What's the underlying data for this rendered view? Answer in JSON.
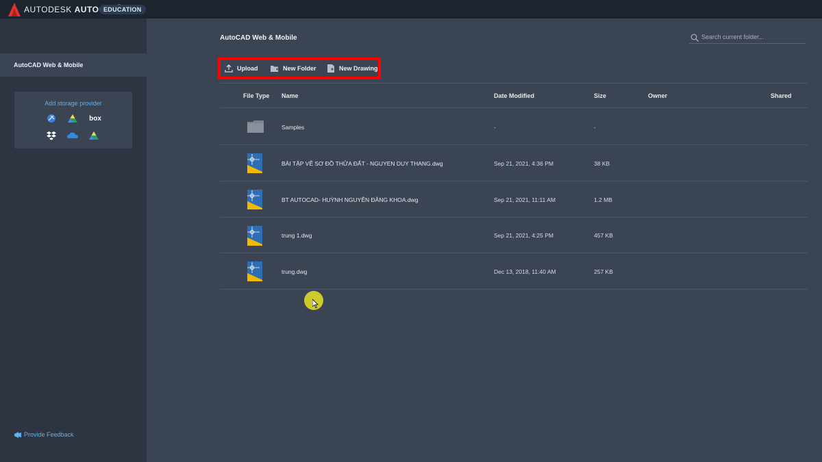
{
  "app": {
    "brand_company": "AUTODESK",
    "brand_product": "AUTOCAD",
    "brand_mark": "®",
    "edition_badge": "EDUCATION"
  },
  "sidebar": {
    "item_label": "AutoCAD Web & Mobile",
    "storage_title": "Add storage provider",
    "providers": [
      "autocad-web-icon",
      "google-drive-icon",
      "box-icon",
      "dropbox-icon",
      "onedrive-icon",
      "google-drive-icon"
    ],
    "box_label": "box",
    "feedback_label": "Provide Feedback"
  },
  "main": {
    "title": "AutoCAD Web & Mobile",
    "search_placeholder": "Search current folder..."
  },
  "toolbar": {
    "upload_label": "Upload",
    "new_folder_label": "New Folder",
    "new_drawing_label": "New Drawing",
    "highlight_color": "#ff0000"
  },
  "table": {
    "headers": {
      "file_type": "File Type",
      "name": "Name",
      "date_modified": "Date Modified",
      "size": "Size",
      "owner": "Owner",
      "shared": "Shared"
    },
    "rows": [
      {
        "type": "folder",
        "name": "Samples",
        "date": "-",
        "size": "-"
      },
      {
        "type": "dwg",
        "name": "BÀI TẬP VẼ SƠ ĐỒ THỬA ĐẤT - NGUYEN DUY THANG.dwg",
        "date": "Sep 21, 2021, 4:36 PM",
        "size": "38 KB"
      },
      {
        "type": "dwg",
        "name": "BT AUTOCAD- HUỲNH NGUYỄN ĐĂNG KHOA.dwg",
        "date": "Sep 21, 2021, 11:11 AM",
        "size": "1.2 MB"
      },
      {
        "type": "dwg",
        "name": "trung 1.dwg",
        "date": "Sep 21, 2021, 4:25 PM",
        "size": "457 KB"
      },
      {
        "type": "dwg",
        "name": "trung.dwg",
        "date": "Dec 13, 2018, 11:40 AM",
        "size": "257 KB"
      }
    ]
  },
  "colors": {
    "accent_link": "#5fb1f0",
    "dwg_blue": "#2f6db5",
    "dwg_yellow": "#f5b800",
    "folder_gray": "#8b919a"
  }
}
